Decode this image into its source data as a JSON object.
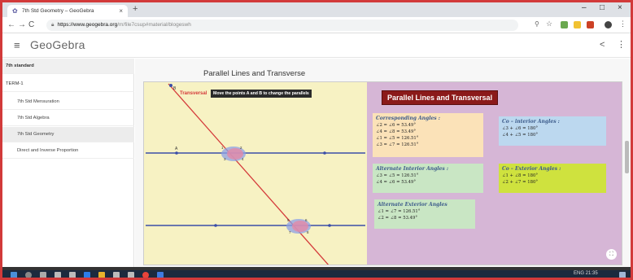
{
  "browser": {
    "tab_title": "7th Std Geometry – GeoGebra",
    "tab_close": "×",
    "new_tab": "+",
    "url_domain": "https://www.geogebra.org",
    "url_path": "/m/file7csup#material/blogeswh",
    "window_controls": [
      "–",
      "□",
      "×"
    ],
    "nav": [
      "←",
      "→",
      "C",
      "⌂"
    ]
  },
  "app": {
    "logo": "GeoGebra",
    "menu_icon": "≡",
    "share_icon": "<",
    "more_icon": "⋮"
  },
  "sidebar": {
    "items": [
      {
        "label": "7th standard",
        "kind": "head"
      },
      {
        "label": "TERM-1",
        "kind": "plain"
      },
      {
        "label": "7th Std Mensuration",
        "kind": "sub"
      },
      {
        "label": "7th Std Algebra",
        "kind": "sub"
      },
      {
        "label": "7th Std Geometry",
        "kind": "sub-active"
      },
      {
        "label": "Direct and Inverse Proportion",
        "kind": "plain"
      }
    ]
  },
  "main": {
    "page_title": "Parallel Lines and Transverse",
    "graphics": {
      "transversal_label": "Transversal",
      "instruction": "Move the points A and B to change the parallels",
      "point_labels": [
        "B",
        "A",
        "1",
        "2",
        "3",
        "4",
        "5",
        "6",
        "7",
        "8"
      ]
    },
    "algebra_title": "Parallel Lines and Transversal",
    "corresponding": {
      "title": "Corresponding Angles :",
      "lines": [
        "∠2 = ∠6 = 53.49°",
        "∠4 = ∠8 = 53.49°",
        "∠1 = ∠5 = 126.51°",
        "∠3 = ∠7 = 126.51°"
      ]
    },
    "co_interior": {
      "title": "Co – interior Angles :",
      "lines": [
        "∠3 + ∠6 = 180°",
        "∠4 + ∠5 = 180°"
      ]
    },
    "alternate_interior": {
      "title": "Alternate Interior Angles :",
      "lines": [
        "∠3 = ∠5 = 126.51°",
        "∠4 = ∠6 = 53.49°"
      ]
    },
    "co_exterior": {
      "title": "Co – Exterior Angles :",
      "lines": [
        "∠1 + ∠8 = 180°",
        "∠2 + ∠7 = 180°"
      ]
    },
    "alternate_exterior": {
      "title": "Alternate Exterior Angles",
      "lines": [
        "∠1 = ∠7 = 126.51°",
        "∠2 = ∠8 = 53.49°"
      ]
    },
    "fullscreen_icon": "⛶"
  },
  "taskbar": {
    "tray_text": "ENG 21:35"
  }
}
